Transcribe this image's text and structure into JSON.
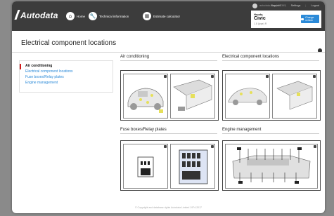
{
  "app": {
    "logo": "Autodata"
  },
  "nav": {
    "home": "Home",
    "technical_information": "Technical information",
    "estimate_calculator": "Estimate calculator"
  },
  "account": {
    "user": "autodata-user Y12345"
  },
  "top_links": {
    "support": "Support",
    "settings": "Settings",
    "logout": "Logout"
  },
  "vehicle": {
    "make": "Honda",
    "model": "Civic",
    "spec": "1.8 (type) R",
    "change_label": "Change vehicle"
  },
  "page": {
    "title": "Electrical component locations"
  },
  "side_nav": {
    "items": [
      {
        "label": "Air conditioning",
        "active": true
      },
      {
        "label": "Electrical component locations",
        "active": false
      },
      {
        "label": "Fuse boxes/Relay plates",
        "active": false
      },
      {
        "label": "Engine management",
        "active": false
      }
    ]
  },
  "sections": [
    {
      "title": "Air conditioning"
    },
    {
      "title": "Electrical component locations"
    },
    {
      "title": "Fuse boxes/Relay plates"
    },
    {
      "title": "Engine management"
    }
  ],
  "footer": {
    "text": "© Copyright and database rights Autodata Limited 1974-2017"
  },
  "colors": {
    "topbar": "#3c3c3c",
    "accent": "#2b8ad8",
    "active_marker": "#d11b1b"
  }
}
